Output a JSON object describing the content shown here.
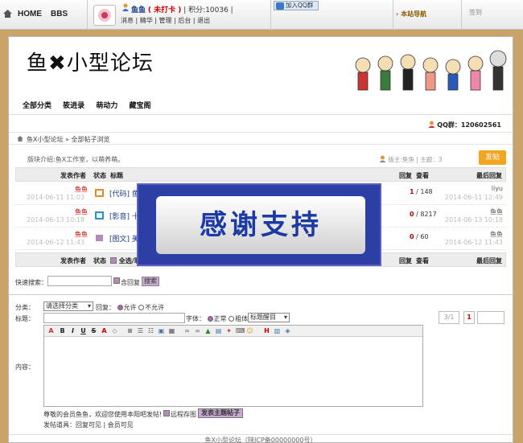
{
  "topbar": {
    "home": "HOME",
    "bbs": "BBS",
    "user_name": "鱼鱼",
    "checkin": "( 未打卡 )",
    "points": "| 积分:10036 |",
    "links": "消息 | 精华 | 管理 | 后台 | 退出",
    "qq_button": "加入QQ群",
    "guide": "本站导航",
    "signin": "签到"
  },
  "site": {
    "logo_a": "鱼",
    "logo_x": "✖",
    "logo_b": "小型论坛",
    "nav": [
      "全部分类",
      "筱进录",
      "萌动力",
      "藏宝阁"
    ],
    "qq_group": "QQ群：120602561"
  },
  "breadcrumb": "鱼X小型论坛 » 全部帖子浏览",
  "board": {
    "intro": "版块介绍:鱼X工作室，以萌养萌。",
    "moderator": "版主:鱼鱼 | 主题：3",
    "post_button": "发帖"
  },
  "table": {
    "headers": {
      "author": "发表作者",
      "status": "状态",
      "title": "标题",
      "reply": "回复",
      "view": "查看",
      "last": "最后回复"
    },
    "rows": [
      {
        "author": "鱼鱼",
        "date": "2014-06-11 11:03",
        "title": "[代码] 鱼X",
        "replies": "1",
        "views": "/ 148",
        "last_user": "liyu",
        "last_time": "2014-06-11 12:49",
        "icon_color": "#e38b2c"
      },
      {
        "author": "鱼鱼",
        "date": "2014-06-13 10:18",
        "title": "[影音] 十大",
        "replies": "0",
        "views": "/ 8217",
        "last_user": "鱼鱼",
        "last_time": "2014-06-13 10:18",
        "icon_color": "#3a8ac8"
      },
      {
        "author": "鱼鱼",
        "date": "2014-06-12 11:43",
        "title": "[图文] 美图",
        "replies": "0",
        "views": "/ 60",
        "last_user": "鱼鱼",
        "last_time": "2014-06-12 11:43",
        "icon_color": "#b48ab8"
      }
    ],
    "footer_select": "全选/取消"
  },
  "overlay_text": "感谢支持",
  "quick_search": {
    "label": "快速搜索：",
    "option": "含回复",
    "button": "搜索"
  },
  "pagination": {
    "current": "3/1",
    "page": "1"
  },
  "form": {
    "category_label": "分类：",
    "category_value": "请选择分类",
    "reply_label": "回复：",
    "allow": "允许",
    "disallow": "不允许",
    "title_label": "标题：",
    "font_label": "字体：",
    "normal": "正常",
    "bold": "粗体",
    "title_color": "标题醒目",
    "content_label": "内容：",
    "notice": "尊敬的会员鱼鱼，欢迎您使用本阳吧发帖!",
    "remote_image": "远程存图",
    "submit": "发表主题帖子",
    "props": "发帖道具：回复可见 | 会员可见"
  },
  "footer": "鱼X小型论坛（陕ICP备00000000号）"
}
